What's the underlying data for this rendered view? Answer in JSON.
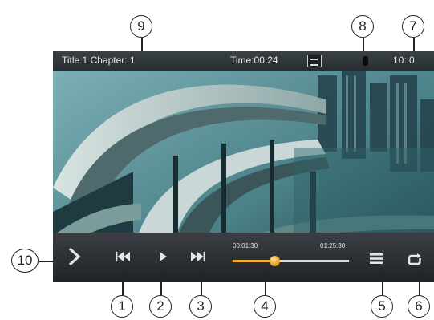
{
  "status_bar": {
    "title_chapter": "Title 1 Chapter: 1",
    "time": "Time:00:24",
    "clock": "10::0",
    "subtitle_icon": "subtitle-icon",
    "badge_icon": "b-icon"
  },
  "controls": {
    "nav_icon": "chevron-right-icon",
    "prev_icon": "skip-previous-icon",
    "play_icon": "play-icon",
    "next_icon": "skip-next-icon",
    "list_icon": "menu-list-icon",
    "repeat_icon": "repeat-icon"
  },
  "progress": {
    "elapsed": "00:01:30",
    "total": "01:25:30",
    "fraction": 0.36
  },
  "colors": {
    "progress_fill": "#f0b12c",
    "bar_background": "#2b2f33"
  },
  "callouts": {
    "c1": "1",
    "c2": "2",
    "c3": "3",
    "c4": "4",
    "c5": "5",
    "c6": "6",
    "c7": "7",
    "c8": "8",
    "c9": "9",
    "c10": "10"
  }
}
